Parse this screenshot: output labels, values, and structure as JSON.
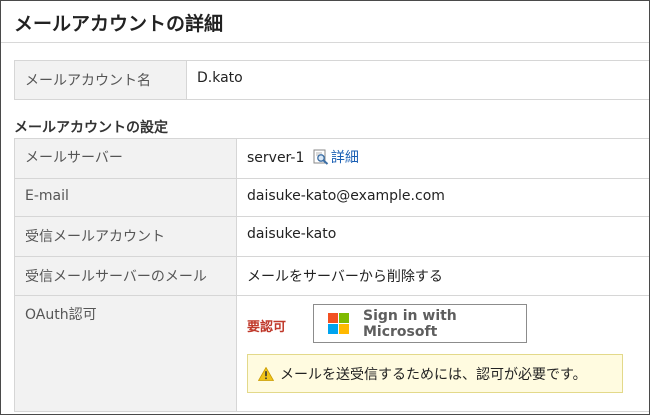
{
  "page": {
    "title": "メールアカウントの詳細"
  },
  "account": {
    "name_label": "メールアカウント名",
    "name_value": "D.kato"
  },
  "settings": {
    "section_title": "メールアカウントの設定",
    "server_label": "メールサーバー",
    "server_value": "server-1",
    "server_detail_link": "詳細",
    "email_label": "E-mail",
    "email_value": "daisuke-kato@example.com",
    "incoming_account_label": "受信メールアカウント",
    "incoming_account_value": "daisuke-kato",
    "incoming_server_mail_label": "受信メールサーバーのメール",
    "incoming_server_mail_value": "メールをサーバーから削除する",
    "oauth_label": "OAuth認可",
    "oauth_status": "要認可",
    "ms_button_label": "Sign in with Microsoft",
    "warning_text": "メールを送受信するためには、認可が必要です。"
  },
  "colors": {
    "status_red": "#c0392b",
    "link_blue": "#1a5fb4",
    "warning_bg": "#fffbe0",
    "ms_red": "#f25022",
    "ms_green": "#7fba00",
    "ms_blue": "#00a4ef",
    "ms_yellow": "#ffb900"
  },
  "icons": {
    "detail": "magnifier-icon",
    "warning": "warning-triangle-icon",
    "microsoft": "microsoft-logo-icon"
  }
}
